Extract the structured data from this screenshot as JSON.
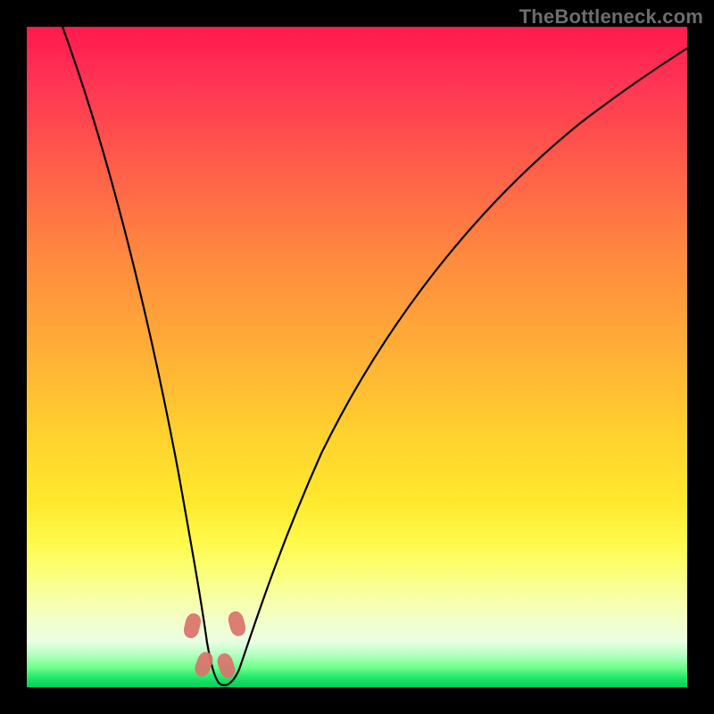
{
  "watermark": {
    "text": "TheBottleneck.com"
  },
  "chart_data": {
    "type": "line",
    "title": "",
    "xlabel": "",
    "ylabel": "",
    "xlim": [
      0,
      100
    ],
    "ylim": [
      0,
      100
    ],
    "grid": false,
    "legend": false,
    "series": [
      {
        "name": "bottleneck-curve",
        "x": [
          0,
          4,
          8,
          12,
          16,
          19,
          22,
          24,
          26,
          27,
          28,
          29,
          30,
          32,
          36,
          40,
          45,
          50,
          56,
          63,
          70,
          78,
          86,
          93,
          98,
          100
        ],
        "y": [
          100,
          88,
          77,
          66,
          54,
          43,
          32,
          22,
          13,
          8,
          3,
          1,
          2,
          5,
          12,
          21,
          31,
          40,
          49,
          58,
          66,
          74,
          80,
          84,
          87,
          88
        ]
      }
    ],
    "markers": [
      {
        "name": "marker-left-upper",
        "x": 25.0,
        "y": 10.0
      },
      {
        "name": "marker-right-upper",
        "x": 31.5,
        "y": 10.0
      },
      {
        "name": "marker-left-lower",
        "x": 26.5,
        "y": 4.5
      },
      {
        "name": "marker-right-lower",
        "x": 30.0,
        "y": 4.5
      }
    ],
    "background_gradient": {
      "top": "#ff1a4d",
      "mid": "#ffe92e",
      "bottom": "#00d05a"
    }
  }
}
